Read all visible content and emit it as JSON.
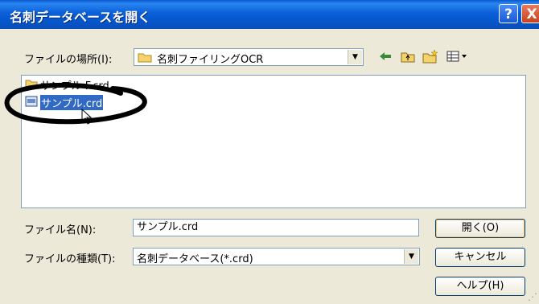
{
  "window": {
    "title": "名刺データベースを開く",
    "help_glyph": "?",
    "close_glyph": "X"
  },
  "location": {
    "label": "ファイルの場所(I):",
    "current_folder": "名刺ファイリングOCR"
  },
  "toolbar_icons": [
    "back-arrow-icon",
    "up-folder-icon",
    "new-folder-icon",
    "view-menu-icon"
  ],
  "files": [
    {
      "name": "サンプル F.crd",
      "icon": "folder-icon",
      "selected": false
    },
    {
      "name": "サンプル.crd",
      "icon": "crd-file-icon",
      "selected": true
    }
  ],
  "filename": {
    "label": "ファイル名(N):",
    "value": "サンプル.crd"
  },
  "filetype": {
    "label": "ファイルの種類(T):",
    "value": "名刺データベース(*.crd)"
  },
  "buttons": {
    "open": "開く(O)",
    "cancel": "キャンセル",
    "help": "ヘルプ(H)"
  },
  "colors": {
    "titlebar": "#0a5fd8",
    "dialog_bg": "#ece9d8",
    "selection": "#316ac5"
  }
}
